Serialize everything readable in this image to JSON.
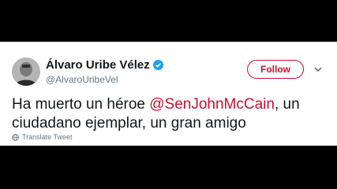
{
  "tweet": {
    "author_name": "Álvaro Uribe Vélez",
    "author_handle": "@AlvaroUribeVel",
    "follow_label": "Follow",
    "text_before": "Ha muerto un héroe ",
    "mention": "@SenJohnMcCain",
    "text_after": ", un ciudadano ejemplar, un gran amigo",
    "translate_label": "Translate Tweet",
    "verified_icon": "verified-badge-icon",
    "more_icon": "chevron-down-icon",
    "translate_icon": "globe-icon",
    "colors": {
      "accent": "#c8102e",
      "verified": "#1da1f2",
      "text": "#14171a",
      "muted": "#657786"
    }
  }
}
